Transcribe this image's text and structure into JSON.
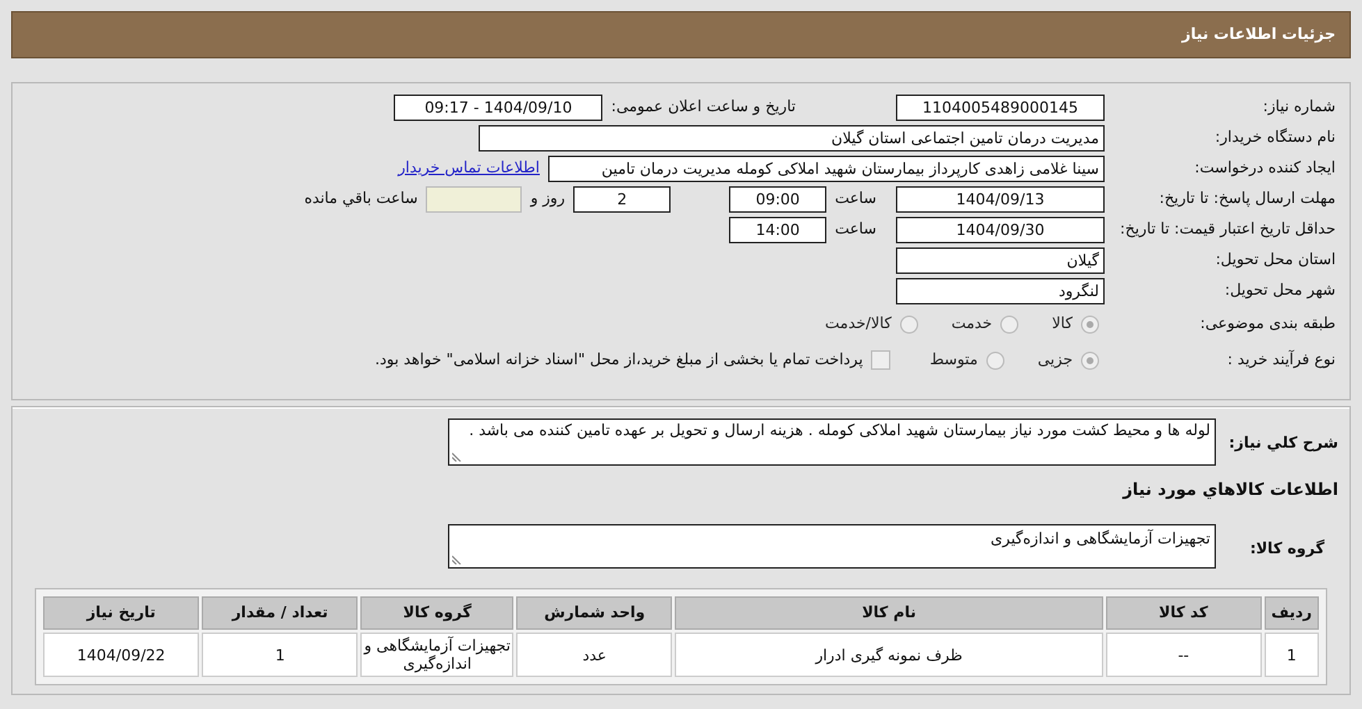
{
  "header": {
    "title": "جزئیات اطلاعات نیاز"
  },
  "need_number": {
    "label": "شماره نیاز:",
    "value": "1104005489000145"
  },
  "announce": {
    "label": "تاریخ و ساعت اعلان عمومی:",
    "value": "1404/09/10 - 09:17"
  },
  "buyer": {
    "label": "نام دستگاه خریدار:",
    "value": "مدیریت درمان تامین اجتماعی استان گیلان"
  },
  "requester": {
    "label": "ایجاد کننده درخواست:",
    "value": "سینا غلامی زاهدی کارپرداز بیمارستان شهید املاکی کومله مدیریت درمان تامین",
    "link": "اطلاعات تماس خریدار"
  },
  "reply_deadline": {
    "label": "مهلت ارسال پاسخ: تا تاریخ:",
    "date": "1404/09/13",
    "time_label": "ساعت",
    "time": "09:00",
    "days": "2",
    "days_label": "روز و",
    "remaining_label": "ساعت باقي مانده"
  },
  "price_validity": {
    "label": "حداقل تاریخ اعتبار قیمت: تا تاریخ:",
    "date": "1404/09/30",
    "time_label": "ساعت",
    "time": "14:00"
  },
  "province": {
    "label": "استان محل تحویل:",
    "value": "گیلان"
  },
  "city": {
    "label": "شهر محل تحویل:",
    "value": "لنگرود"
  },
  "category": {
    "label": "طبقه بندی موضوعی:",
    "options": [
      {
        "label": "کالا",
        "selected": true
      },
      {
        "label": "خدمت",
        "selected": false
      },
      {
        "label": "کالا/خدمت",
        "selected": false
      }
    ]
  },
  "process": {
    "label": "نوع فرآیند خرید :",
    "options": [
      {
        "label": "جزیی",
        "selected": true
      },
      {
        "label": "متوسط",
        "selected": false
      }
    ],
    "checkbox": {
      "checked": false,
      "label": "پرداخت تمام یا بخشی از مبلغ خرید،از محل \"اسناد خزانه اسلامی\" خواهد بود."
    }
  },
  "description": {
    "label": "شرح کلي نیاز:",
    "value": "لوله ها و محیط کشت مورد نیاز بیمارستان شهید املاکی کومله . هزینه ارسال و تحویل بر عهده تامین کننده می باشد ."
  },
  "goods_title": "اطلاعات کالاهاي مورد نیاز",
  "goods_group": {
    "label": "گروه کالا:",
    "value": "تجهیزات آزمایشگاهی و اندازه‌گیری"
  },
  "table": {
    "columns": [
      "ردیف",
      "کد کالا",
      "نام کالا",
      "واحد شمارش",
      "گروه کالا",
      "تعداد / مقدار",
      "تاریخ نیاز"
    ],
    "rows": [
      [
        "1",
        "--",
        "ظرف نمونه گیری ادرار",
        "عدد",
        "تجهیزات آزمایشگاهی و اندازه‌گیری",
        "1",
        "1404/09/22"
      ]
    ]
  }
}
